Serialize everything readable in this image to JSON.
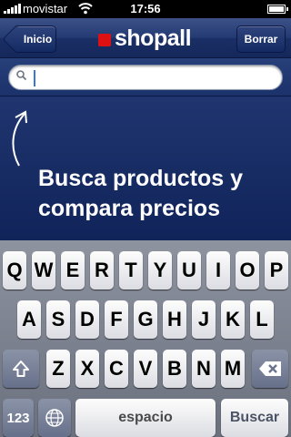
{
  "status_bar": {
    "carrier": "movistar",
    "time": "17:56"
  },
  "nav": {
    "back_label": "Inicio",
    "clear_label": "Borrar",
    "logo_text": "shopall",
    "accent": "#d11111"
  },
  "search": {
    "placeholder": "",
    "value": ""
  },
  "hint": {
    "message_line1": "Busca productos y",
    "message_line2": "compara precios"
  },
  "keyboard": {
    "row1": [
      "Q",
      "W",
      "E",
      "R",
      "T",
      "Y",
      "U",
      "I",
      "O",
      "P"
    ],
    "row2": [
      "A",
      "S",
      "D",
      "F",
      "G",
      "H",
      "J",
      "K",
      "L"
    ],
    "row3": [
      "Z",
      "X",
      "C",
      "V",
      "B",
      "N",
      "M"
    ],
    "numbers_label": "123",
    "space_label": "espacio",
    "search_label": "Buscar",
    "shift_icon": "shift-icon",
    "delete_icon": "backspace-icon",
    "globe_icon": "globe-icon"
  }
}
